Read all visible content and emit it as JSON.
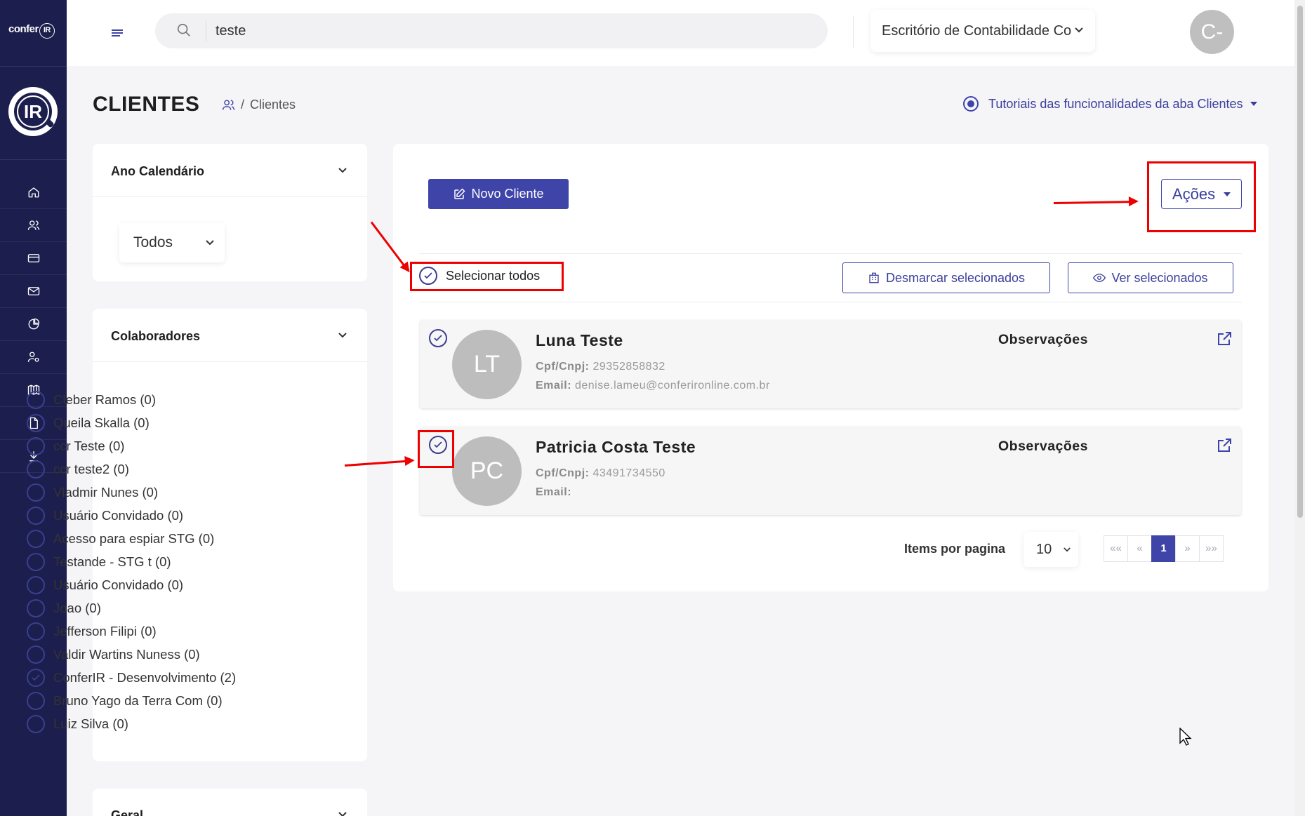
{
  "app": {
    "logo_text": "confer",
    "logo_ir": "IR",
    "badge_text": "IR"
  },
  "topbar": {
    "search_value": "teste",
    "office": "Escritório de Contabilidade Co",
    "user_initials": "C-"
  },
  "sidebar": {
    "items": [
      {
        "icon": "home-icon"
      },
      {
        "icon": "users-icon"
      },
      {
        "icon": "card-icon"
      },
      {
        "icon": "mail-icon"
      },
      {
        "icon": "pie-chart-icon"
      },
      {
        "icon": "user-settings-icon"
      },
      {
        "icon": "book-icon"
      },
      {
        "icon": "document-icon"
      },
      {
        "icon": "download-icon"
      }
    ]
  },
  "page": {
    "title": "CLIENTES",
    "breadcrumb": "Clientes",
    "breadcrumb_sep": "/",
    "tutorials": "Tutoriais das funcionalidades da aba Clientes"
  },
  "filters": {
    "year": {
      "title": "Ano Calendário",
      "value": "Todos"
    },
    "collaborators": {
      "title": "Colaboradores",
      "items": [
        {
          "label": "Cleber Ramos (0)",
          "checked": false
        },
        {
          "label": "Queila Skalla (0)",
          "checked": false
        },
        {
          "label": "ccr Teste (0)",
          "checked": false
        },
        {
          "label": "ccr teste2 (0)",
          "checked": false
        },
        {
          "label": "Vladmir Nunes (0)",
          "checked": false
        },
        {
          "label": "Usuário Convidado (0)",
          "checked": false
        },
        {
          "label": "Acesso para espiar STG (0)",
          "checked": false
        },
        {
          "label": "Testande - STG t (0)",
          "checked": false
        },
        {
          "label": "Usuário Convidado (0)",
          "checked": false
        },
        {
          "label": "Joao (0)",
          "checked": false
        },
        {
          "label": "Jefferson Filipi (0)",
          "checked": false
        },
        {
          "label": "Valdir Wartins Nuness (0)",
          "checked": false
        },
        {
          "label": "ConferIR - Desenvolvimento (2)",
          "checked": true
        },
        {
          "label": "Bruno Yago da Terra Com (0)",
          "checked": false
        },
        {
          "label": "Luiz Silva (0)",
          "checked": false
        }
      ]
    },
    "general": {
      "title": "Geral"
    }
  },
  "main": {
    "new_client": "Novo Cliente",
    "actions": "Ações",
    "select_all": "Selecionar todos",
    "unselect": "Desmarcar selecionados",
    "view_selected": "Ver selecionados",
    "clients": [
      {
        "initials": "LT",
        "name": "Luna Teste",
        "cpf_label": "Cpf/Cnpj:",
        "cpf": "29352858832",
        "email_label": "Email:",
        "email": "denise.lameu@conferironline.com.br",
        "obs_label": "Observações",
        "checked": true
      },
      {
        "initials": "PC",
        "name": "Patricia Costa Teste",
        "cpf_label": "Cpf/Cnpj:",
        "cpf": "43491734550",
        "email_label": "Email:",
        "email": "",
        "obs_label": "Observações",
        "checked": true
      }
    ],
    "pagination": {
      "items_label": "Items por pagina",
      "per_page": "10",
      "first": "««",
      "prev": "«",
      "current": "1",
      "next": "»",
      "last": "»»"
    }
  },
  "colors": {
    "sidebar": "#1c1e4e",
    "primary": "#3f44a8",
    "highlight": "#e00000"
  }
}
